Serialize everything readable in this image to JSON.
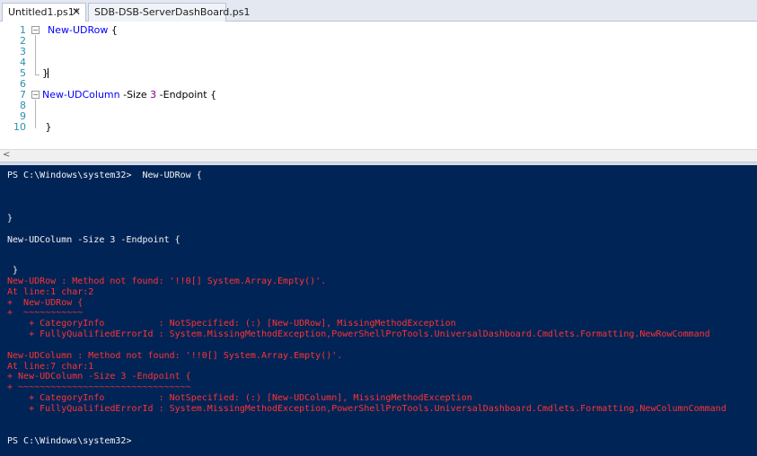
{
  "tabs": [
    {
      "label": "Untitled1.ps1*",
      "close_icon": "close-icon",
      "active": true
    },
    {
      "label": "SDB-DSB-ServerDashBoard.ps1",
      "active": false
    }
  ],
  "editor": {
    "line_numbers": [
      "1",
      "2",
      "3",
      "4",
      "5",
      "6",
      "7",
      "8",
      "9",
      "10"
    ],
    "lines": [
      {
        "cmd": "New-UDRow",
        "rest": " {"
      },
      {
        "text": ""
      },
      {
        "text": ""
      },
      {
        "text": ""
      },
      {
        "text": "}"
      },
      {
        "text": ""
      },
      {
        "cmd": "New-UDColumn",
        "rest_a": " -Size ",
        "num": "3",
        "rest_b": " -Endpoint {"
      },
      {
        "text": ""
      },
      {
        "text": ""
      },
      {
        "text": " }"
      }
    ]
  },
  "scrollbar": {
    "left_arrow": "<"
  },
  "console": {
    "lines": [
      {
        "text": "PS C:\\Windows\\system32>  New-UDRow {",
        "error": false
      },
      {
        "text": "",
        "error": false
      },
      {
        "text": "",
        "error": false
      },
      {
        "text": "}",
        "error": false
      },
      {
        "text": "",
        "error": false
      },
      {
        "text": "New-UDColumn -Size 3 -Endpoint {",
        "error": false
      },
      {
        "text": "",
        "error": false
      },
      {
        "text": "",
        "error": false
      },
      {
        "text": " }",
        "error": false
      },
      {
        "text": "New-UDRow : Method not found: '!!0[] System.Array.Empty()'.",
        "error": true
      },
      {
        "text": "At line:1 char:2",
        "error": true
      },
      {
        "text": "+  New-UDRow {",
        "error": true
      },
      {
        "text": "+  ~~~~~~~~~~~",
        "error": true
      },
      {
        "text": "    + CategoryInfo          : NotSpecified: (:) [New-UDRow], MissingMethodException",
        "error": true
      },
      {
        "text": "    + FullyQualifiedErrorId : System.MissingMethodException,PowerShellProTools.UniversalDashboard.Cmdlets.Formatting.NewRowCommand",
        "error": true
      },
      {
        "text": "",
        "error": true
      },
      {
        "text": "New-UDColumn : Method not found: '!!0[] System.Array.Empty()'.",
        "error": true
      },
      {
        "text": "At line:7 char:1",
        "error": true
      },
      {
        "text": "+ New-UDColumn -Size 3 -Endpoint {",
        "error": true
      },
      {
        "text": "+ ~~~~~~~~~~~~~~~~~~~~~~~~~~~~~~~~",
        "error": true
      },
      {
        "text": "    + CategoryInfo          : NotSpecified: (:) [New-UDColumn], MissingMethodException",
        "error": true
      },
      {
        "text": "    + FullyQualifiedErrorId : System.MissingMethodException,PowerShellProTools.UniversalDashboard.Cmdlets.Formatting.NewColumnCommand",
        "error": true
      },
      {
        "text": "",
        "error": false
      },
      {
        "text": "",
        "error": false
      },
      {
        "text": "PS C:\\Windows\\system32>",
        "error": false
      }
    ]
  },
  "colors": {
    "console_bg": "#012456",
    "console_text": "#f5f5f5",
    "error_text": "#ff3333",
    "cmdlet": "#0000ff",
    "number": "#800080",
    "line_number": "#2b91af"
  }
}
